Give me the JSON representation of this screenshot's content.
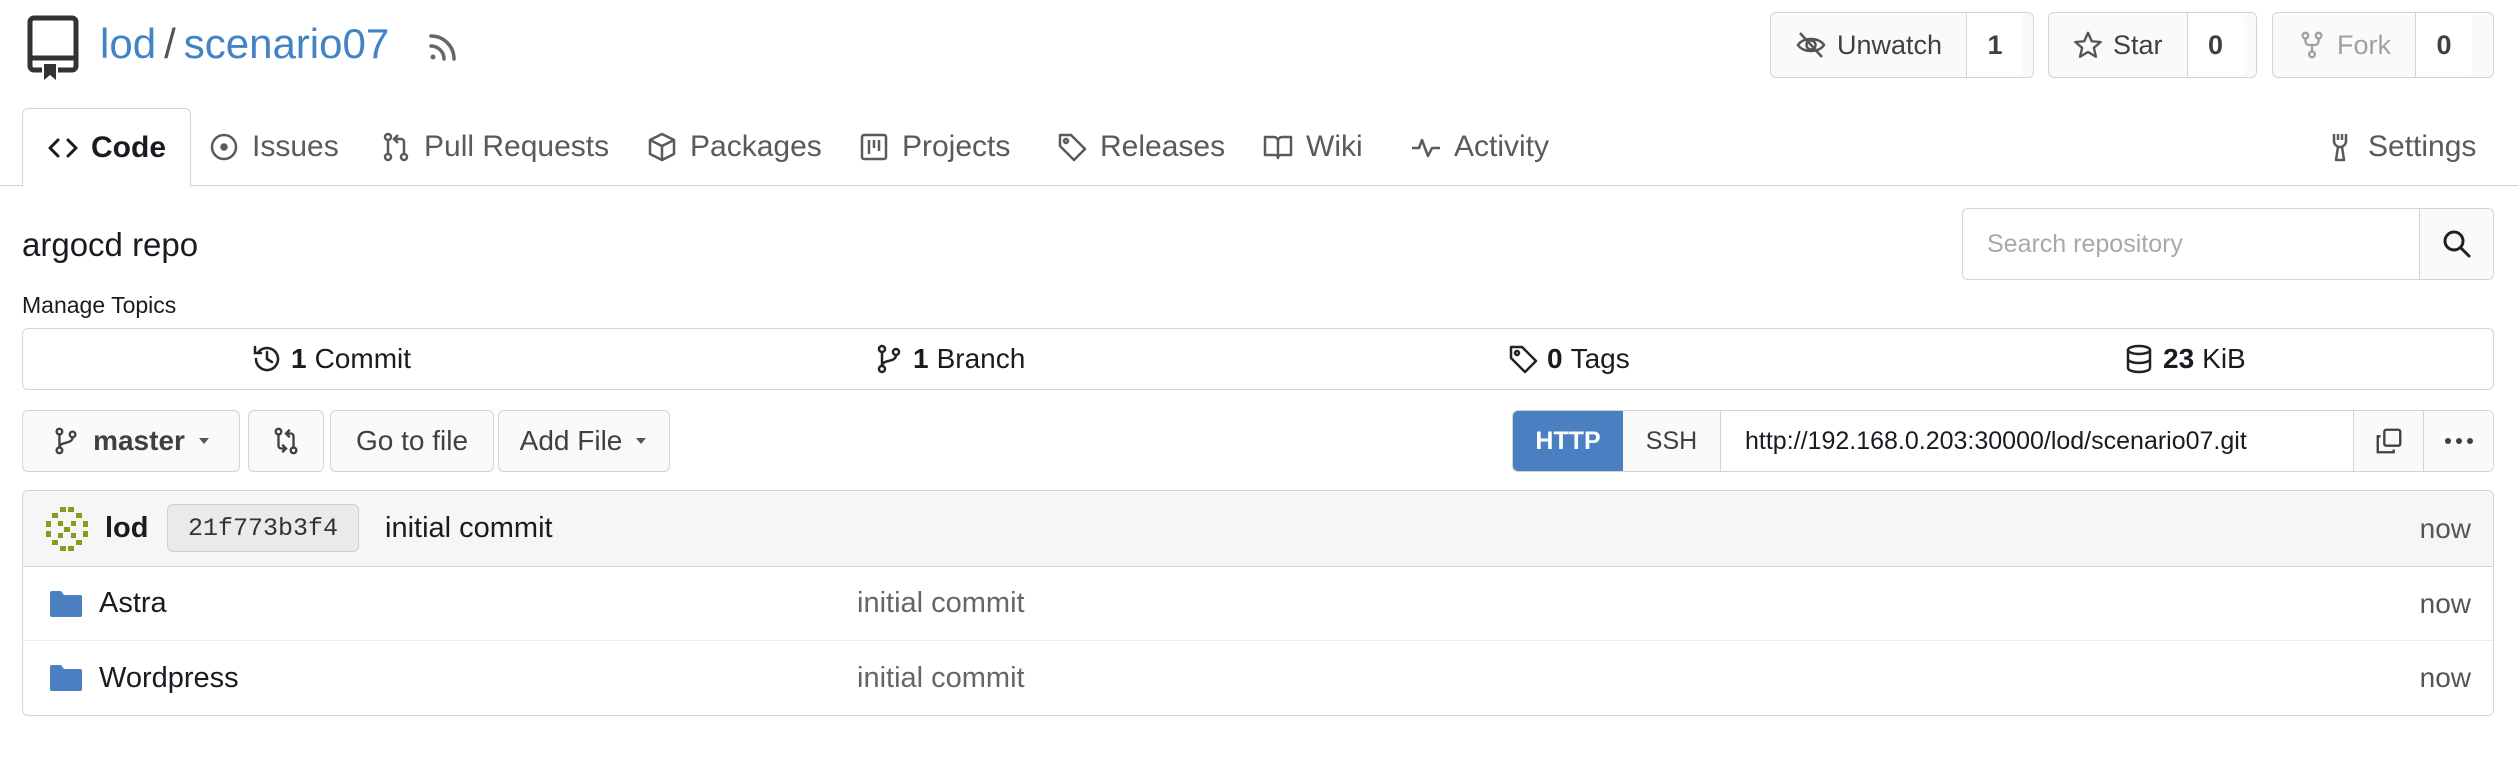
{
  "repo": {
    "owner": "lod",
    "separator": "/",
    "name": "scenario07",
    "description": "argocd repo",
    "manage_topics": "Manage Topics"
  },
  "actions": {
    "watch": {
      "label": "Unwatch",
      "count": "1"
    },
    "star": {
      "label": "Star",
      "count": "0"
    },
    "fork": {
      "label": "Fork",
      "count": "0"
    }
  },
  "tabs": [
    {
      "label": "Code",
      "icon": "code-icon",
      "active": true
    },
    {
      "label": "Issues",
      "icon": "issue-icon"
    },
    {
      "label": "Pull Requests",
      "icon": "pull-request-icon"
    },
    {
      "label": "Packages",
      "icon": "package-icon"
    },
    {
      "label": "Projects",
      "icon": "project-icon"
    },
    {
      "label": "Releases",
      "icon": "tag-icon"
    },
    {
      "label": "Wiki",
      "icon": "book-icon"
    },
    {
      "label": "Activity",
      "icon": "pulse-icon"
    },
    {
      "label": "Settings",
      "icon": "tools-icon"
    }
  ],
  "search": {
    "placeholder": "Search repository"
  },
  "stats": {
    "commits": {
      "count": "1",
      "label": "Commit"
    },
    "branches": {
      "count": "1",
      "label": "Branch"
    },
    "tags": {
      "count": "0",
      "label": "Tags"
    },
    "size": {
      "count": "23",
      "label": "KiB"
    }
  },
  "branch": {
    "current": "master",
    "go_to_file": "Go to file",
    "add_file": "Add File"
  },
  "clone": {
    "http_label": "HTTP",
    "ssh_label": "SSH",
    "url": "http://192.168.0.203:30000/lod/scenario07.git"
  },
  "latest_commit": {
    "author": "lod",
    "sha": "21f773b3f4",
    "message": "initial commit",
    "time": "now"
  },
  "files": [
    {
      "name": "Astra",
      "message": "initial commit",
      "time": "now",
      "type": "folder"
    },
    {
      "name": "Wordpress",
      "message": "initial commit",
      "time": "now",
      "type": "folder"
    }
  ],
  "colors": {
    "link": "#4183c4",
    "primary": "#4a7fc1",
    "folder": "#4a7fc1",
    "avatar": "#8a9a1b"
  }
}
